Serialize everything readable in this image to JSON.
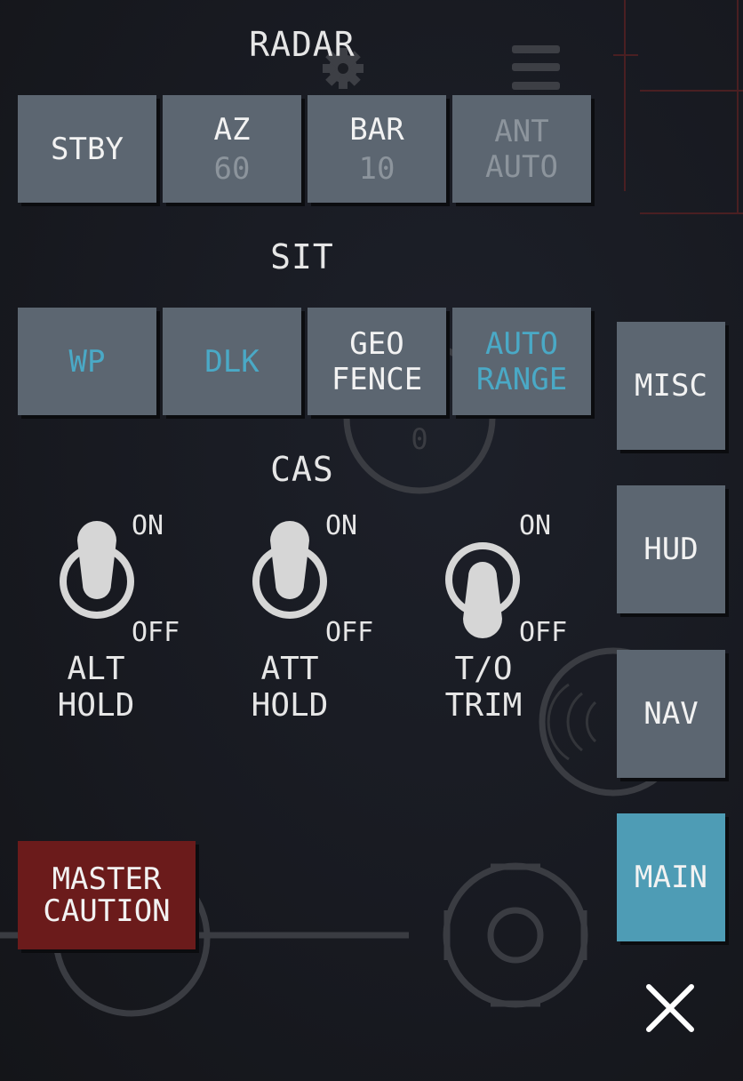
{
  "radar": {
    "title": "RADAR",
    "buttons": [
      {
        "label": "STBY",
        "value": ""
      },
      {
        "label": "AZ",
        "value": "60"
      },
      {
        "label": "BAR",
        "value": "10"
      },
      {
        "label": "ANT",
        "value": "AUTO"
      }
    ]
  },
  "sit": {
    "title": "SIT",
    "buttons": [
      {
        "line1": "WP",
        "line2": ""
      },
      {
        "line1": "DLK",
        "line2": ""
      },
      {
        "line1": "GEO",
        "line2": "FENCE"
      },
      {
        "line1": "AUTO",
        "line2": "RANGE"
      }
    ]
  },
  "cas": {
    "title": "CAS",
    "toggles": [
      {
        "line1": "ALT",
        "line2": "HOLD",
        "on_label": "ON",
        "off_label": "OFF",
        "state": "on"
      },
      {
        "line1": "ATT",
        "line2": "HOLD",
        "on_label": "ON",
        "off_label": "OFF",
        "state": "on"
      },
      {
        "line1": "T/O",
        "line2": "TRIM",
        "on_label": "ON",
        "off_label": "OFF",
        "state": "off"
      }
    ]
  },
  "side_menu": {
    "items": [
      {
        "label": "MISC",
        "active": false
      },
      {
        "label": "HUD",
        "active": false
      },
      {
        "label": "NAV",
        "active": false
      },
      {
        "label": "MAIN",
        "active": true
      }
    ]
  },
  "master_caution": {
    "line1": "MASTER",
    "line2": "CAUTION"
  },
  "background_text": {
    "dial_value": "0"
  },
  "colors": {
    "button": "#5c6671",
    "accent": "#4aa9c6",
    "active": "#4e9cb5",
    "caution": "#6b1b1b"
  },
  "icons": [
    "gear-icon",
    "menu-icon",
    "close-icon",
    "toggle-switch-icon"
  ]
}
